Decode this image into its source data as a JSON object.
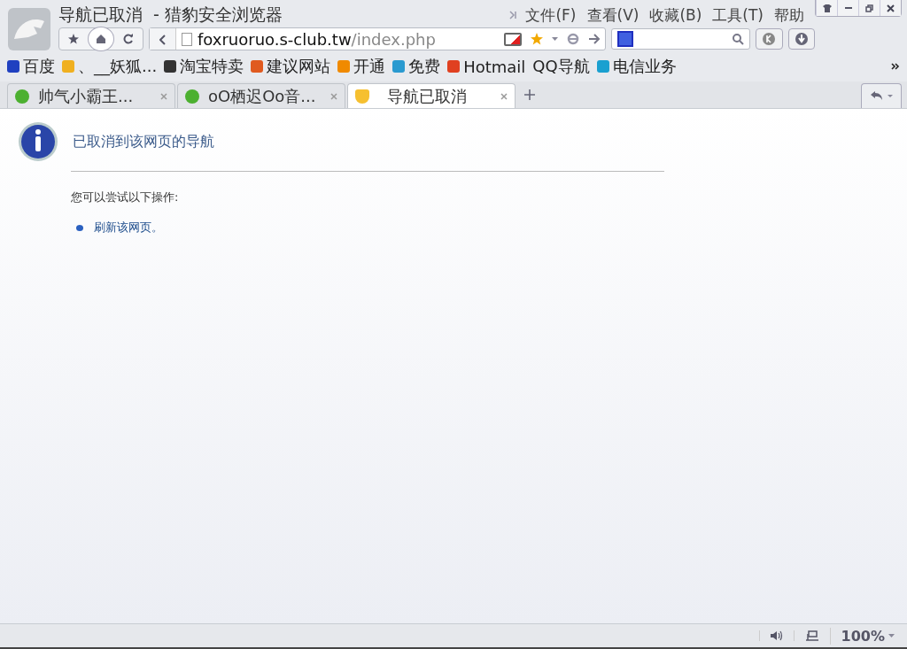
{
  "window": {
    "title": "导航已取消  - 猎豹安全浏览器"
  },
  "menu": [
    "文件(F)",
    "查看(V)",
    "收藏(B)",
    "工具(T)",
    "帮助"
  ],
  "address": {
    "host": "foxruoruo.s-club.tw",
    "path": "/index.php"
  },
  "bookmarks": [
    {
      "label": "百度"
    },
    {
      "label": "、__妖狐..."
    },
    {
      "label": "淘宝特卖"
    },
    {
      "label": "建议网站"
    },
    {
      "label": "开通"
    },
    {
      "label": "免费"
    },
    {
      "label": "Hotmail"
    },
    {
      "label": "QQ导航"
    },
    {
      "label": "电信业务"
    }
  ],
  "tabs": [
    {
      "label": "帅气小霸王...",
      "selected": false
    },
    {
      "label": "oO栖迟Oo音...",
      "selected": false
    },
    {
      "label": "导航已取消",
      "selected": true
    }
  ],
  "page": {
    "heading": "已取消到该网页的导航",
    "intro": "您可以尝试以下操作:",
    "actions": [
      "刷新该网页。"
    ]
  },
  "status_bar": {
    "zoom": "100%"
  }
}
